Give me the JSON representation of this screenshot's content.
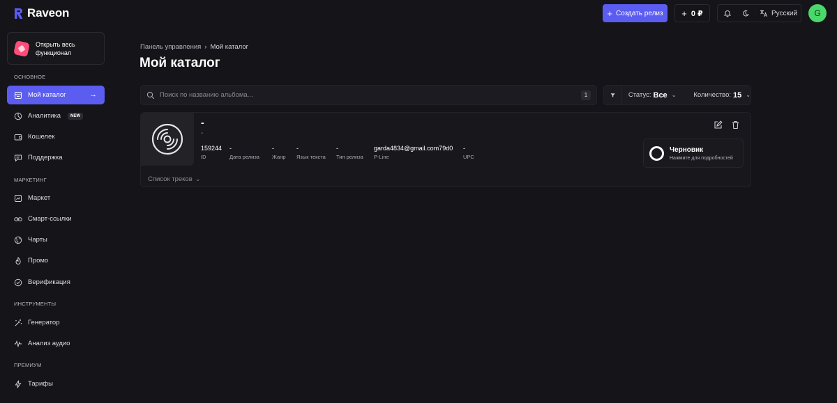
{
  "brand": {
    "name": "Raveon",
    "accent": "#5b5cf0"
  },
  "header": {
    "create_label": "Создать релиз",
    "balance": "0 ₽",
    "language": "Русский",
    "avatar_letter": "G"
  },
  "sidebar": {
    "promo_text": "Открыть весь функционал",
    "sections": {
      "main": "ОСНОВНОЕ",
      "marketing": "МАРКЕТИНГ",
      "tools": "ИНСТРУМЕНТЫ",
      "premium": "ПРЕМИУМ"
    },
    "items": {
      "catalog": "Мой каталог",
      "analytics": "Аналитика",
      "analytics_badge": "NEW",
      "wallet": "Кошелек",
      "support": "Поддержка",
      "market": "Маркет",
      "smartlinks": "Смарт-ссылки",
      "charts": "Чарты",
      "promo": "Промо",
      "verification": "Верификация",
      "generator": "Генератор",
      "audio_analysis": "Анализ аудио",
      "tariffs": "Тарифы"
    }
  },
  "breadcrumb": {
    "root": "Панель управления",
    "current": "Мой каталог"
  },
  "page_title": "Мой каталог",
  "search": {
    "placeholder": "Поиск по названию альбома...",
    "count": "1"
  },
  "filters": {
    "status_label": "Статус:",
    "status_value": "Все",
    "count_label": "Количество:",
    "count_value": "15"
  },
  "release": {
    "title": "-",
    "artist": "-",
    "meta": {
      "id": {
        "value": "159244",
        "label": "ID"
      },
      "release_date": {
        "value": "-",
        "label": "Дата релиза"
      },
      "genre": {
        "value": "-",
        "label": "Жанр"
      },
      "lyrics_lang": {
        "value": "-",
        "label": "Язык текста"
      },
      "release_type": {
        "value": "-",
        "label": "Тип релиза"
      },
      "pline": {
        "value": "garda4834@gmail.com79d0",
        "label": "P-Line"
      },
      "upc": {
        "value": "-",
        "label": "UPC"
      }
    },
    "status": {
      "title": "Черновик",
      "hint": "Нажмите для подробностей"
    },
    "tracks_toggle": "Список треков"
  }
}
